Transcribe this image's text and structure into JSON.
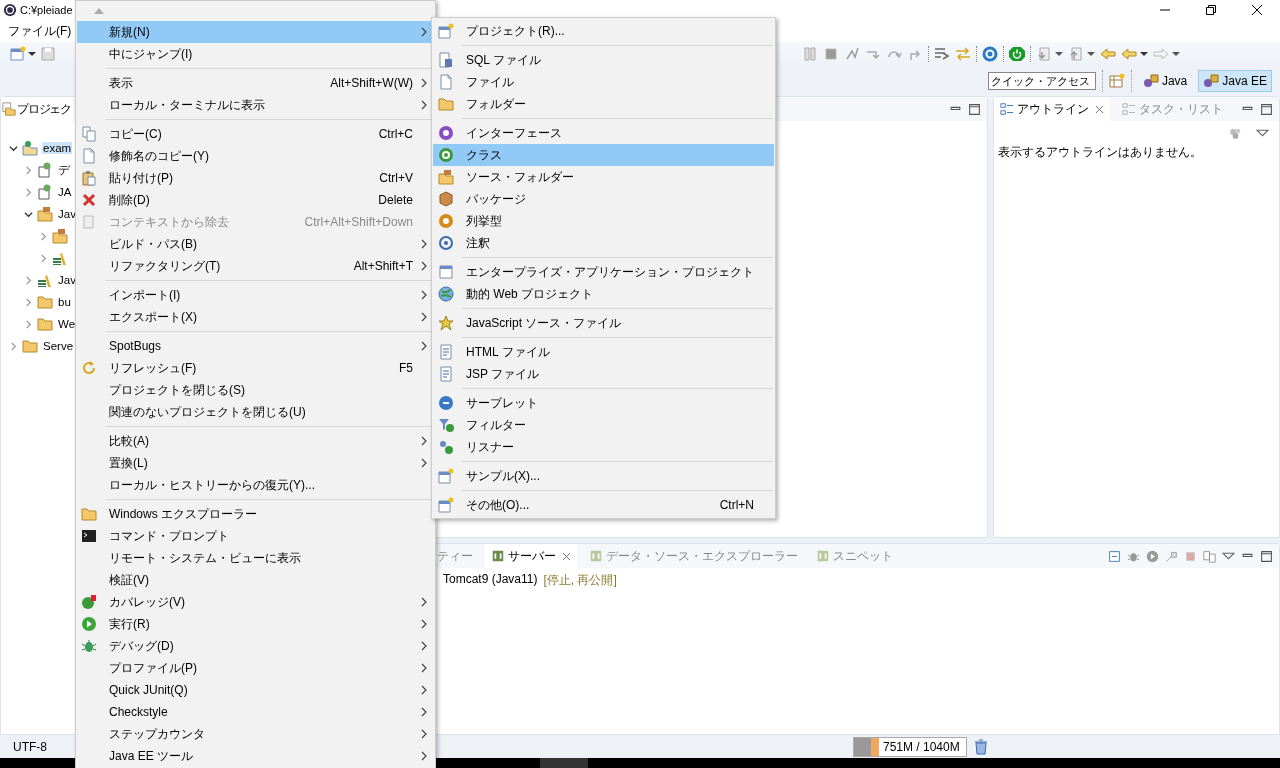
{
  "window": {
    "title": "C:¥pleiade"
  },
  "menu_bar": [
    {
      "label": "ファイル(F)"
    }
  ],
  "quick_access": {
    "placeholder": "クイック・アクセス"
  },
  "perspectives": [
    {
      "label": "Java",
      "selected": false
    },
    {
      "label": "Java EE",
      "selected": true
    }
  ],
  "project_explorer": {
    "tab": "プロジェク",
    "tree": [
      {
        "label": "exam",
        "expanded": true,
        "selected": true,
        "children": [
          {
            "label": "デ",
            "expanded": false,
            "selected": false
          },
          {
            "label": "JA",
            "expanded": false,
            "selected": false
          },
          {
            "label": "Jav",
            "expanded": true,
            "selected": false,
            "children": [
              {
                "expanded": false
              },
              {
                "expanded": false
              }
            ]
          },
          {
            "label": "Jav",
            "expanded": false,
            "selected": false
          },
          {
            "label": "bu",
            "expanded": false,
            "selected": false
          },
          {
            "label": "We",
            "expanded": false,
            "selected": false
          }
        ]
      },
      {
        "label": "Serve",
        "expanded": false,
        "selected": false
      }
    ]
  },
  "outline": {
    "tabs": [
      {
        "label": "アウトライン",
        "selected": true
      },
      {
        "label": "タスク・リスト",
        "selected": false
      }
    ],
    "message": "表示するアウトラインはありません。"
  },
  "bottom_panel": {
    "tabs": [
      {
        "label": "ティー",
        "selected": false
      },
      {
        "label": "サーバー",
        "selected": true
      },
      {
        "label": "データ・ソース・エクスプローラー",
        "selected": false
      },
      {
        "label": "スニペット",
        "selected": false
      }
    ],
    "servers": [
      {
        "name": "Tomcat9 (Java11)",
        "status": "[停止, 再公開]"
      }
    ]
  },
  "status_bar": {
    "encoding": "UTF-8",
    "heap": {
      "reading": "751M / 1040M",
      "level": 0.22
    }
  },
  "context_menu": {
    "items": [
      {
        "kind": "item",
        "label": "新規(N)",
        "submenu": true,
        "selected": true,
        "disabled": false,
        "icon": false
      },
      {
        "kind": "item",
        "label": "中にジャンプ(I)",
        "submenu": false,
        "selected": false,
        "disabled": false,
        "icon": false
      },
      {
        "kind": "separator"
      },
      {
        "kind": "item",
        "label": "表示",
        "shortcut": "Alt+Shift+W(W)",
        "submenu": true,
        "selected": false,
        "disabled": false,
        "icon": false
      },
      {
        "kind": "item",
        "label": "ローカル・ターミナルに表示",
        "submenu": true,
        "selected": false,
        "disabled": false,
        "icon": false
      },
      {
        "kind": "separator"
      },
      {
        "kind": "item",
        "label": "コピー(C)",
        "shortcut": "Ctrl+C",
        "submenu": false,
        "selected": false,
        "disabled": false,
        "icon": true
      },
      {
        "kind": "item",
        "label": "修飾名のコピー(Y)",
        "submenu": false,
        "selected": false,
        "disabled": false,
        "icon": true
      },
      {
        "kind": "item",
        "label": "貼り付け(P)",
        "shortcut": "Ctrl+V",
        "submenu": false,
        "selected": false,
        "disabled": false,
        "icon": true
      },
      {
        "kind": "item",
        "label": "削除(D)",
        "shortcut": "Delete",
        "submenu": false,
        "selected": false,
        "disabled": false,
        "icon": true
      },
      {
        "kind": "item",
        "label": "コンテキストから除去",
        "shortcut": "Ctrl+Alt+Shift+Down",
        "submenu": false,
        "selected": false,
        "disabled": true,
        "icon": true
      },
      {
        "kind": "item",
        "label": "ビルド・パス(B)",
        "submenu": true,
        "selected": false,
        "disabled": false,
        "icon": false
      },
      {
        "kind": "item",
        "label": "リファクタリング(T)",
        "shortcut": "Alt+Shift+T",
        "submenu": true,
        "selected": false,
        "disabled": false,
        "icon": false
      },
      {
        "kind": "separator"
      },
      {
        "kind": "item",
        "label": "インポート(I)",
        "submenu": true,
        "selected": false,
        "disabled": false,
        "icon": false
      },
      {
        "kind": "item",
        "label": "エクスポート(X)",
        "submenu": true,
        "selected": false,
        "disabled": false,
        "icon": false
      },
      {
        "kind": "separator"
      },
      {
        "kind": "item",
        "label": "SpotBugs",
        "submenu": true,
        "selected": false,
        "disabled": false,
        "icon": false
      },
      {
        "kind": "item",
        "label": "リフレッシュ(F)",
        "shortcut": "F5",
        "submenu": false,
        "selected": false,
        "disabled": false,
        "icon": true
      },
      {
        "kind": "item",
        "label": "プロジェクトを閉じる(S)",
        "submenu": false,
        "selected": false,
        "disabled": false,
        "icon": false
      },
      {
        "kind": "item",
        "label": "関連のないプロジェクトを閉じる(U)",
        "submenu": false,
        "selected": false,
        "disabled": false,
        "icon": false
      },
      {
        "kind": "separator"
      },
      {
        "kind": "item",
        "label": "比較(A)",
        "submenu": true,
        "selected": false,
        "disabled": false,
        "icon": false
      },
      {
        "kind": "item",
        "label": "置換(L)",
        "submenu": true,
        "selected": false,
        "disabled": false,
        "icon": false
      },
      {
        "kind": "item",
        "label": "ローカル・ヒストリーからの復元(Y)...",
        "submenu": false,
        "selected": false,
        "disabled": false,
        "icon": false
      },
      {
        "kind": "separator"
      },
      {
        "kind": "item",
        "label": "Windows エクスプローラー",
        "submenu": false,
        "selected": false,
        "disabled": false,
        "icon": true
      },
      {
        "kind": "item",
        "label": "コマンド・プロンプト",
        "submenu": false,
        "selected": false,
        "disabled": false,
        "icon": true
      },
      {
        "kind": "item",
        "label": "リモート・システム・ビューに表示",
        "submenu": false,
        "selected": false,
        "disabled": false,
        "icon": false
      },
      {
        "kind": "item",
        "label": "検証(V)",
        "submenu": false,
        "selected": false,
        "disabled": false,
        "icon": false
      },
      {
        "kind": "item",
        "label": "カバレッジ(V)",
        "submenu": true,
        "selected": false,
        "disabled": false,
        "icon": true
      },
      {
        "kind": "item",
        "label": "実行(R)",
        "submenu": true,
        "selected": false,
        "disabled": false,
        "icon": true
      },
      {
        "kind": "item",
        "label": "デバッグ(D)",
        "submenu": true,
        "selected": false,
        "disabled": false,
        "icon": true
      },
      {
        "kind": "item",
        "label": "プロファイル(P)",
        "submenu": true,
        "selected": false,
        "disabled": false,
        "icon": false
      },
      {
        "kind": "item",
        "label": "Quick JUnit(Q)",
        "submenu": true,
        "selected": false,
        "disabled": false,
        "icon": false
      },
      {
        "kind": "item",
        "label": "Checkstyle",
        "submenu": true,
        "selected": false,
        "disabled": false,
        "icon": false
      },
      {
        "kind": "item",
        "label": "ステップカウンタ",
        "submenu": true,
        "selected": false,
        "disabled": false,
        "icon": false
      },
      {
        "kind": "item",
        "label": "Java EE ツール",
        "submenu": true,
        "selected": false,
        "disabled": false,
        "icon": false
      }
    ]
  },
  "submenu": {
    "items": [
      {
        "kind": "item",
        "label": "プロジェクト(R)...",
        "selected": false,
        "icon": true
      },
      {
        "kind": "separator"
      },
      {
        "kind": "item",
        "label": "SQL ファイル",
        "selected": false,
        "icon": true
      },
      {
        "kind": "item",
        "label": "ファイル",
        "selected": false,
        "icon": true
      },
      {
        "kind": "item",
        "label": "フォルダー",
        "selected": false,
        "icon": true
      },
      {
        "kind": "separator"
      },
      {
        "kind": "item",
        "label": "インターフェース",
        "selected": false,
        "icon": true
      },
      {
        "kind": "item",
        "label": "クラス",
        "selected": true,
        "icon": true
      },
      {
        "kind": "item",
        "label": "ソース・フォルダー",
        "selected": false,
        "icon": true
      },
      {
        "kind": "item",
        "label": "パッケージ",
        "selected": false,
        "icon": true
      },
      {
        "kind": "item",
        "label": "列挙型",
        "selected": false,
        "icon": true
      },
      {
        "kind": "item",
        "label": "注釈",
        "selected": false,
        "icon": true
      },
      {
        "kind": "separator"
      },
      {
        "kind": "item",
        "label": "エンタープライズ・アプリケーション・プロジェクト",
        "selected": false,
        "icon": true
      },
      {
        "kind": "item",
        "label": "動的 Web プロジェクト",
        "selected": false,
        "icon": true
      },
      {
        "kind": "separator"
      },
      {
        "kind": "item",
        "label": "JavaScript ソース・ファイル",
        "selected": false,
        "icon": true
      },
      {
        "kind": "separator"
      },
      {
        "kind": "item",
        "label": "HTML ファイル",
        "selected": false,
        "icon": true
      },
      {
        "kind": "item",
        "label": "JSP ファイル",
        "selected": false,
        "icon": true
      },
      {
        "kind": "separator"
      },
      {
        "kind": "item",
        "label": "サーブレット",
        "selected": false,
        "icon": true
      },
      {
        "kind": "item",
        "label": "フィルター",
        "selected": false,
        "icon": true
      },
      {
        "kind": "item",
        "label": "リスナー",
        "selected": false,
        "icon": true
      },
      {
        "kind": "separator"
      },
      {
        "kind": "item",
        "label": "サンプル(X)...",
        "selected": false,
        "icon": true
      },
      {
        "kind": "separator"
      },
      {
        "kind": "item",
        "label": "その他(O)...",
        "shortcut": "Ctrl+N",
        "selected": false,
        "icon": true
      }
    ]
  }
}
